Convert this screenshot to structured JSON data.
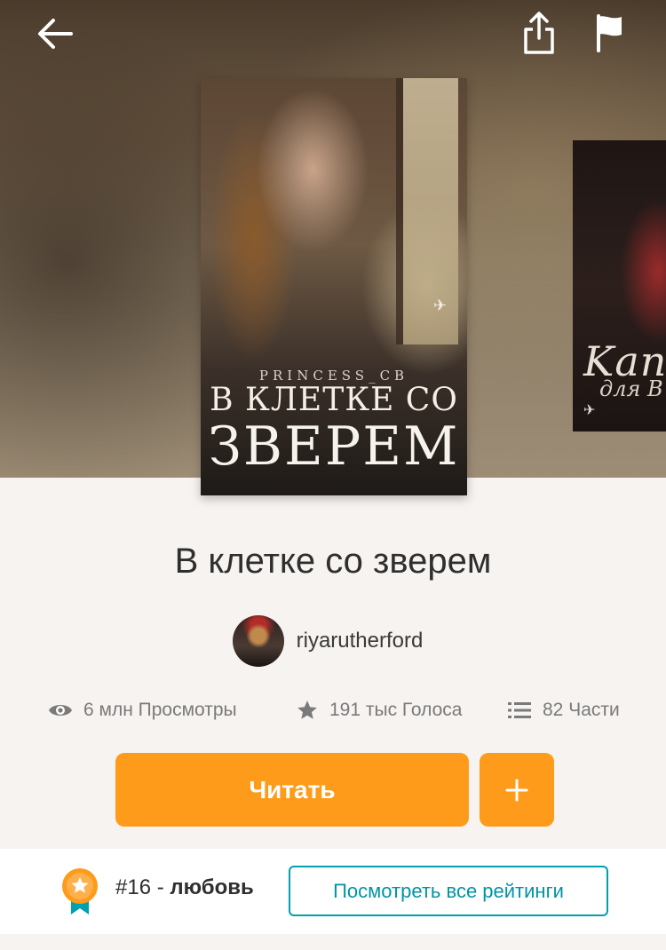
{
  "header": {
    "back_icon": "arrow-left-icon",
    "share_icon": "share-icon",
    "flag_icon": "flag-icon"
  },
  "cover": {
    "author_text": "PRINCESS_CB",
    "title_line1": "В КЛЕТКЕ СО",
    "title_line2": "ЗВЕРЕМ"
  },
  "next_cover": {
    "title_line1": "Kап",
    "title_line2": "для В"
  },
  "book": {
    "title": "В клетке со зверем",
    "author": "riyarutherford"
  },
  "stats": {
    "views": "6 млн Просмотры",
    "votes": "191 тыс Голоса",
    "parts": "82 Части"
  },
  "actions": {
    "read_label": "Читать",
    "add_label": "+"
  },
  "ranking": {
    "rank": "#16",
    "separator": " - ",
    "category": "любовь",
    "view_all_label": "Посмотреть все рейтинги"
  },
  "colors": {
    "accent": "#ff9b1a",
    "link": "#00a0b0"
  }
}
